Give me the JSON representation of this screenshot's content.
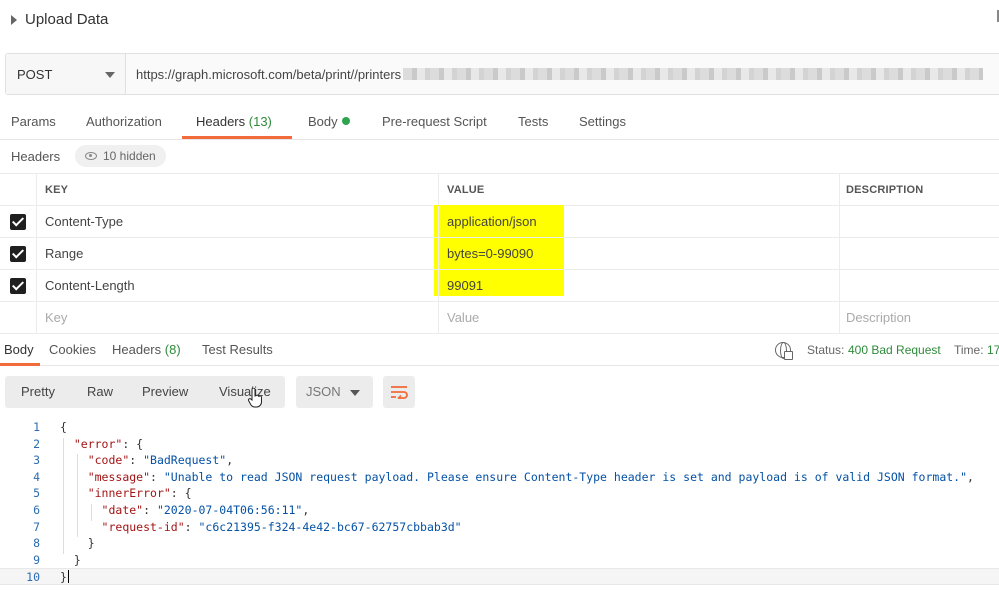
{
  "title": "Upload Data",
  "request": {
    "method": "POST",
    "url": "https://graph.microsoft.com/beta/print//printers"
  },
  "request_tabs": [
    {
      "label": "Params"
    },
    {
      "label": "Authorization"
    },
    {
      "label": "Headers",
      "count": "(13)"
    },
    {
      "label": "Body"
    },
    {
      "label": "Pre-request Script"
    },
    {
      "label": "Tests"
    },
    {
      "label": "Settings"
    }
  ],
  "headers_section": {
    "label": "Headers",
    "hidden_label": "10 hidden"
  },
  "headers_table": {
    "columns": [
      "KEY",
      "VALUE",
      "DESCRIPTION"
    ],
    "rows": [
      {
        "key": "Content-Type",
        "value": "application/json",
        "checked": true
      },
      {
        "key": "Range",
        "value": "bytes=0-99090",
        "checked": true
      },
      {
        "key": "Content-Length",
        "value": "99091",
        "checked": true
      }
    ],
    "placeholder": {
      "key": "Key",
      "value": "Value",
      "description": "Description"
    }
  },
  "response_tabs": [
    {
      "label": "Body"
    },
    {
      "label": "Cookies"
    },
    {
      "label": "Headers",
      "count": "(8)"
    },
    {
      "label": "Test Results"
    }
  ],
  "response_status": {
    "status_label": "Status:",
    "status_value": "400 Bad Request",
    "time_label": "Time:",
    "time_value": "17"
  },
  "view_modes": [
    "Pretty",
    "Raw",
    "Preview",
    "Visualize"
  ],
  "format": "JSON",
  "code_lines": [
    {
      "n": "1",
      "tokens": [
        [
          "p",
          "{"
        ]
      ]
    },
    {
      "n": "2",
      "tokens": [
        [
          "p",
          "  "
        ],
        [
          "k",
          "\"error\""
        ],
        [
          "p",
          ": {"
        ]
      ]
    },
    {
      "n": "3",
      "tokens": [
        [
          "p",
          "    "
        ],
        [
          "k",
          "\"code\""
        ],
        [
          "p",
          ": "
        ],
        [
          "s",
          "\"BadRequest\""
        ],
        [
          "p",
          ","
        ]
      ]
    },
    {
      "n": "4",
      "tokens": [
        [
          "p",
          "    "
        ],
        [
          "k",
          "\"message\""
        ],
        [
          "p",
          ": "
        ],
        [
          "s",
          "\"Unable to read JSON request payload. Please ensure Content-Type header is set and payload is of valid JSON format.\""
        ],
        [
          "p",
          ","
        ]
      ]
    },
    {
      "n": "5",
      "tokens": [
        [
          "p",
          "    "
        ],
        [
          "k",
          "\"innerError\""
        ],
        [
          "p",
          ": {"
        ]
      ]
    },
    {
      "n": "6",
      "tokens": [
        [
          "p",
          "      "
        ],
        [
          "k",
          "\"date\""
        ],
        [
          "p",
          ": "
        ],
        [
          "s",
          "\"2020-07-04T06:56:11\""
        ],
        [
          "p",
          ","
        ]
      ]
    },
    {
      "n": "7",
      "tokens": [
        [
          "p",
          "      "
        ],
        [
          "k",
          "\"request-id\""
        ],
        [
          "p",
          ": "
        ],
        [
          "s",
          "\"c6c21395-f324-4e42-bc67-62757cbbab3d\""
        ]
      ]
    },
    {
      "n": "8",
      "tokens": [
        [
          "p",
          "    }"
        ]
      ]
    },
    {
      "n": "9",
      "tokens": [
        [
          "p",
          "  }"
        ]
      ]
    },
    {
      "n": "10",
      "tokens": [
        [
          "p",
          "}"
        ]
      ]
    }
  ],
  "colors": {
    "accent": "#f26b3a",
    "success": "#2e8b3a",
    "highlight": "#ffff00",
    "json_key": "#a31515",
    "json_string": "#0451a5"
  }
}
